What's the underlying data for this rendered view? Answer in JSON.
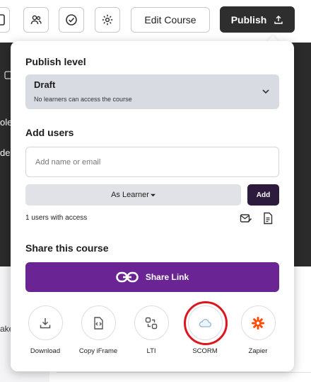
{
  "toolbar": {
    "edit_label": "Edit Course",
    "publish_label": "Publish"
  },
  "background": {
    "fragment_1": "ole,",
    "fragment_2": "de",
    "fragment_3": "ake"
  },
  "publish_level": {
    "title": "Publish level",
    "value": "Draft",
    "description": "No learners can access the course"
  },
  "add_users": {
    "title": "Add users",
    "placeholder": "Add name or email",
    "role_label": "As Learner",
    "add_label": "Add",
    "access_count": "1 users with access"
  },
  "share": {
    "title": "Share this course",
    "share_link_label": "Share Link",
    "options": [
      {
        "label": "Download",
        "icon": "download-icon"
      },
      {
        "label": "Copy iFrame",
        "icon": "code-file-icon"
      },
      {
        "label": "LTI",
        "icon": "lti-icon"
      },
      {
        "label": "SCORM",
        "icon": "cloud-icon"
      },
      {
        "label": "Zapier",
        "icon": "zapier-icon"
      }
    ]
  },
  "colors": {
    "accent_purple": "#6b2494",
    "add_button": "#2d1b3e",
    "publish_button": "#2e2e2e",
    "highlight": "#e0141e",
    "zapier": "#ff4a00",
    "scorm_cloud": "#8fb5d3"
  }
}
